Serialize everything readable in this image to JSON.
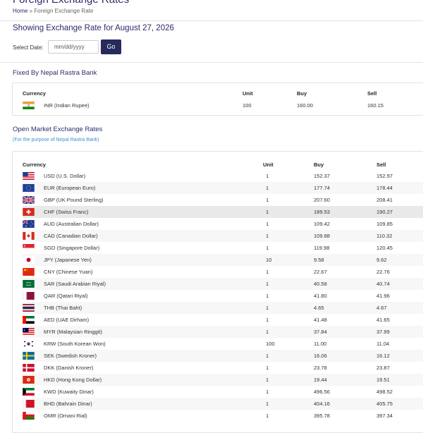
{
  "header": {
    "title": "Foreign Exchange Rates",
    "breadcrumb": {
      "home": "Home",
      "separator": "»",
      "current": "Foreign Exchange Rate"
    }
  },
  "showing": {
    "heading": "Showing Exchange Rate for August 27, 2026"
  },
  "date_form": {
    "label": "Select Date:",
    "placeholder": "mm/dd/yyyy",
    "go_label": "Go"
  },
  "fixed": {
    "heading": "Fixed By Nepal Rastra Bank",
    "columns": {
      "currency": "Currency",
      "unit": "Unit",
      "buy": "Buy",
      "sell": "Sell"
    },
    "rows": [
      {
        "flag": "india-flag-icon",
        "currency": "INR (Indian Rupee)",
        "unit": "100",
        "buy": "160.00",
        "sell": "160.15"
      }
    ]
  },
  "open_market": {
    "heading": "Open Market Exchange Rates",
    "subheading": "(For the purpose of Nepal Rastra Bank)",
    "columns": {
      "currency": "Currency",
      "unit": "Unit",
      "buy": "Buy",
      "sell": "Sell"
    },
    "rows": [
      {
        "flag": "usa-flag-icon",
        "currency": "USD (U.S. Dollar)",
        "unit": "1",
        "buy": "152.37",
        "sell": "152.97"
      },
      {
        "flag": "eu-flag-icon",
        "currency": "EUR (European Euro)",
        "unit": "1",
        "buy": "177.74",
        "sell": "178.44"
      },
      {
        "flag": "uk-flag-icon",
        "currency": "GBP (UK Pound Sterling)",
        "unit": "1",
        "buy": "207.60",
        "sell": "208.41"
      },
      {
        "flag": "switzerland-flag-icon",
        "currency": "CHF (Swiss Franc)",
        "unit": "1",
        "buy": "189.53",
        "sell": "190.27"
      },
      {
        "flag": "australia-flag-icon",
        "currency": "AUD (Australian Dollar)",
        "unit": "1",
        "buy": "109.42",
        "sell": "109.85"
      },
      {
        "flag": "canada-flag-icon",
        "currency": "CAD (Canadian Dollar)",
        "unit": "1",
        "buy": "109.88",
        "sell": "110.32"
      },
      {
        "flag": "singapore-flag-icon",
        "currency": "SGD (Singapore Dollar)",
        "unit": "1",
        "buy": "119.98",
        "sell": "120.45"
      },
      {
        "flag": "japan-flag-icon",
        "currency": "JPY (Japanese Yen)",
        "unit": "10",
        "buy": "9.58",
        "sell": "9.62"
      },
      {
        "flag": "china-flag-icon",
        "currency": "CNY (Chinese Yuan)",
        "unit": "1",
        "buy": "22.67",
        "sell": "22.76"
      },
      {
        "flag": "saudi-flag-icon",
        "currency": "SAR (Saudi Arabian Riyal)",
        "unit": "1",
        "buy": "40.58",
        "sell": "40.74"
      },
      {
        "flag": "qatar-flag-icon",
        "currency": "QAR (Qatari Riyal)",
        "unit": "1",
        "buy": "41.80",
        "sell": "41.96"
      },
      {
        "flag": "thailand-flag-icon",
        "currency": "THB (Thai Baht)",
        "unit": "1",
        "buy": "4.65",
        "sell": "4.67"
      },
      {
        "flag": "uae-flag-icon",
        "currency": "AED (UAE Dirham)",
        "unit": "1",
        "buy": "41.48",
        "sell": "41.65"
      },
      {
        "flag": "malaysia-flag-icon",
        "currency": "MYR (Malaysian Ringgit)",
        "unit": "1",
        "buy": "37.84",
        "sell": "37.99"
      },
      {
        "flag": "south-korea-flag-icon",
        "currency": "KRW (South Korean Won)",
        "unit": "100",
        "buy": "11.00",
        "sell": "11.04"
      },
      {
        "flag": "sweden-flag-icon",
        "currency": "SEK (Swedish Kroner)",
        "unit": "1",
        "buy": "16.06",
        "sell": "16.12"
      },
      {
        "flag": "denmark-flag-icon",
        "currency": "DKK (Danish Kroner)",
        "unit": "1",
        "buy": "23.78",
        "sell": "23.87"
      },
      {
        "flag": "hong-kong-flag-icon",
        "currency": "HKD (Hong Kong Dollar)",
        "unit": "1",
        "buy": "19.44",
        "sell": "19.51"
      },
      {
        "flag": "kuwait-flag-icon",
        "currency": "KWD (Kuwaity Dinar)",
        "unit": "1",
        "buy": "496.56",
        "sell": "498.52"
      },
      {
        "flag": "bahrain-flag-icon",
        "currency": "BHD (Bahrain Dinar)",
        "unit": "1",
        "buy": "404.16",
        "sell": "405.75"
      },
      {
        "flag": "oman-flag-icon",
        "currency": "OMR (Omani Rial)",
        "unit": "1",
        "buy": "395.78",
        "sell": "397.34"
      }
    ]
  },
  "colors": {
    "brand": "#262a5c",
    "link": "#3a8fd4",
    "highlight_row": "#e9e9e9",
    "alt_row": "#f7f7f7"
  }
}
